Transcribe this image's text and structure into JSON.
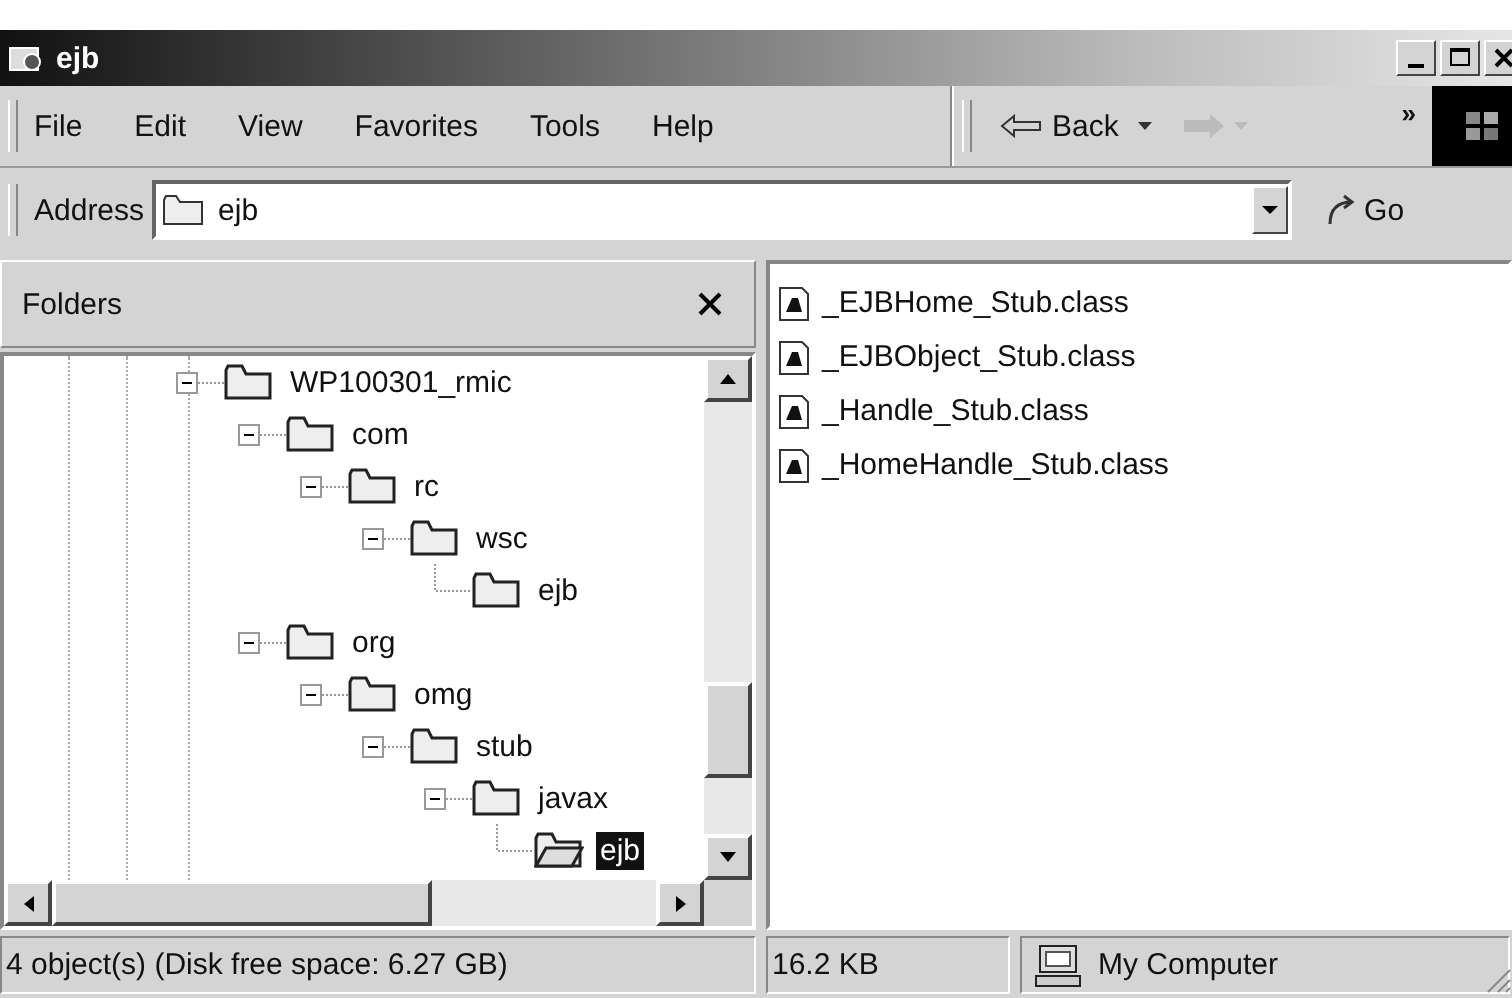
{
  "window": {
    "title": "ejb"
  },
  "menu": [
    "File",
    "Edit",
    "View",
    "Favorites",
    "Tools",
    "Help"
  ],
  "toolbar": {
    "back": "Back",
    "forward_disabled": true,
    "more": "»"
  },
  "address": {
    "label": "Address",
    "value": "ejb",
    "go": "Go"
  },
  "folders_pane": {
    "title": "Folders"
  },
  "tree": [
    {
      "name": "WP100301_rmic",
      "expanded": true,
      "selected": false,
      "children": [
        {
          "name": "com",
          "expanded": true,
          "selected": false,
          "children": [
            {
              "name": "rc",
              "expanded": true,
              "selected": false,
              "children": [
                {
                  "name": "wsc",
                  "expanded": true,
                  "selected": false,
                  "children": [
                    {
                      "name": "ejb",
                      "selected": false
                    }
                  ]
                }
              ]
            }
          ]
        },
        {
          "name": "org",
          "expanded": true,
          "selected": false,
          "children": [
            {
              "name": "omg",
              "expanded": true,
              "selected": false,
              "children": [
                {
                  "name": "stub",
                  "expanded": true,
                  "selected": false,
                  "children": [
                    {
                      "name": "javax",
                      "expanded": true,
                      "selected": false,
                      "children": [
                        {
                          "name": "ejb",
                          "selected": true
                        }
                      ]
                    }
                  ]
                }
              ]
            }
          ]
        }
      ]
    }
  ],
  "files": [
    "_EJBHome_Stub.class",
    "_EJBObject_Stub.class",
    "_Handle_Stub.class",
    "_HomeHandle_Stub.class"
  ],
  "status_bar": {
    "objects": "4 object(s) (Disk free space: 6.27 GB)",
    "size": "16.2 KB",
    "zone": "My Computer"
  }
}
